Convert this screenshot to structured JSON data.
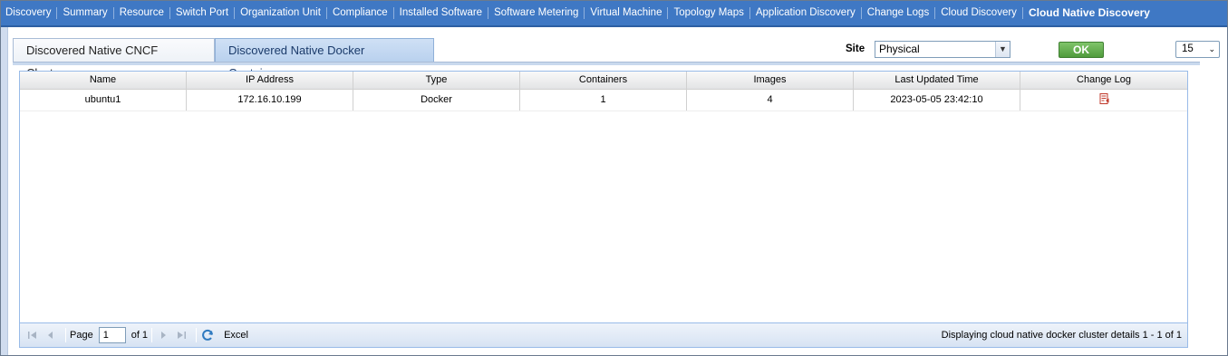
{
  "nav": {
    "items": [
      {
        "label": "Discovery",
        "active": false
      },
      {
        "label": "Summary",
        "active": false
      },
      {
        "label": "Resource",
        "active": false
      },
      {
        "label": "Switch Port",
        "active": false
      },
      {
        "label": "Organization Unit",
        "active": false
      },
      {
        "label": "Compliance",
        "active": false
      },
      {
        "label": "Installed Software",
        "active": false
      },
      {
        "label": "Software Metering",
        "active": false
      },
      {
        "label": "Virtual Machine",
        "active": false
      },
      {
        "label": "Topology Maps",
        "active": false
      },
      {
        "label": "Application Discovery",
        "active": false
      },
      {
        "label": "Change Logs",
        "active": false
      },
      {
        "label": "Cloud Discovery",
        "active": false
      },
      {
        "label": "Cloud Native Discovery",
        "active": true
      }
    ]
  },
  "tabs": {
    "first": "Discovered Native CNCF Clusters",
    "second": "Discovered Native Docker Containers"
  },
  "filter": {
    "site_label": "Site",
    "site_value": "Physical",
    "ok_label": "OK",
    "page_size": "15"
  },
  "grid": {
    "columns": [
      "Name",
      "IP Address",
      "Type",
      "Containers",
      "Images",
      "Last Updated Time",
      "Change Log"
    ],
    "rows": [
      {
        "name": "ubuntu1",
        "ip": "172.16.10.199",
        "type": "Docker",
        "containers": "1",
        "images": "4",
        "updated": "2023-05-05 23:42:10"
      }
    ]
  },
  "footer": {
    "page_label": "Page",
    "page_value": "1",
    "of_label": "of 1",
    "excel_label": "Excel",
    "display_msg": "Displaying cloud native docker cluster details 1 - 1 of 1"
  },
  "colors": {
    "nav_bg": "#3f78c4",
    "active_tab_bg": "#b9d1ee",
    "ok_green": "#4f9b3c",
    "icon_red": "#c0392b"
  }
}
